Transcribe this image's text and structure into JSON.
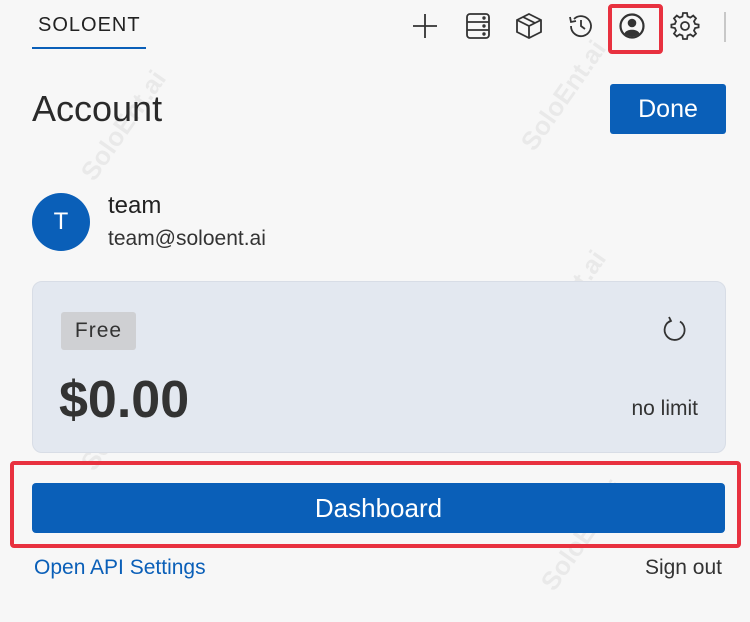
{
  "header": {
    "brand_tab": "SOLOENT",
    "icons": [
      "plus-icon",
      "server-icon",
      "package-icon",
      "history-icon",
      "account-icon",
      "settings-icon"
    ]
  },
  "page": {
    "title": "Account",
    "done_label": "Done"
  },
  "user": {
    "initial": "T",
    "name": "team",
    "email": "team@soloent.ai"
  },
  "plan": {
    "badge": "Free",
    "amount": "$0.00",
    "limit": "no limit"
  },
  "actions": {
    "dashboard_label": "Dashboard",
    "api_settings_label": "Open API Settings",
    "sign_out_label": "Sign out"
  },
  "watermark": "SoloEnt.ai",
  "colors": {
    "accent": "#0a5fb8",
    "highlight": "#e8313f",
    "card_bg": "#e3e8f0",
    "badge_bg": "#cfd0d3"
  }
}
